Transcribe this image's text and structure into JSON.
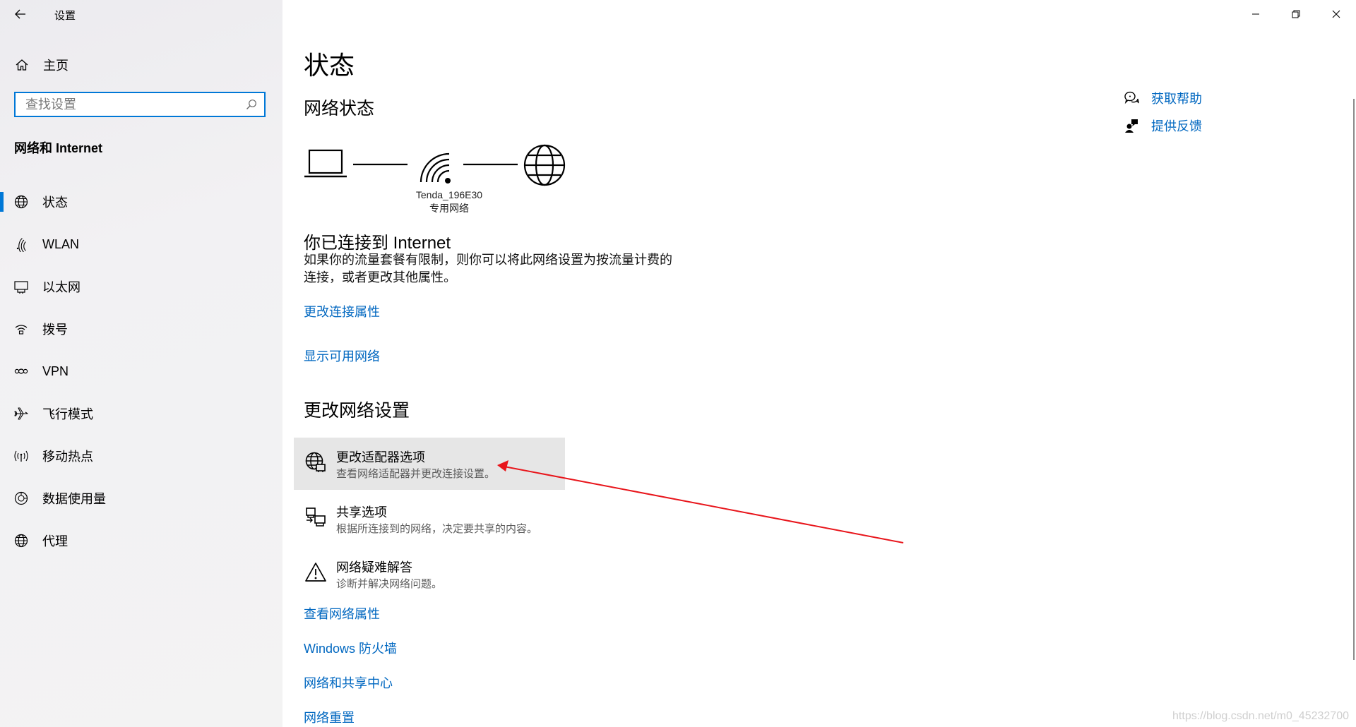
{
  "window": {
    "title": "设置",
    "controls": [
      "minimize",
      "restore",
      "close"
    ]
  },
  "sidebar": {
    "home_label": "主页",
    "search_placeholder": "查找设置",
    "section_title": "网络和 Internet",
    "items": [
      {
        "label": "状态",
        "icon": "globe-status-icon",
        "active": true
      },
      {
        "label": "WLAN",
        "icon": "wifi-icon",
        "active": false
      },
      {
        "label": "以太网",
        "icon": "ethernet-icon",
        "active": false
      },
      {
        "label": "拨号",
        "icon": "dialup-icon",
        "active": false
      },
      {
        "label": "VPN",
        "icon": "vpn-icon",
        "active": false
      },
      {
        "label": "飞行模式",
        "icon": "airplane-icon",
        "active": false
      },
      {
        "label": "移动热点",
        "icon": "hotspot-icon",
        "active": false
      },
      {
        "label": "数据使用量",
        "icon": "data-usage-icon",
        "active": false
      },
      {
        "label": "代理",
        "icon": "proxy-globe-icon",
        "active": false
      }
    ]
  },
  "main": {
    "title": "状态",
    "network_status_title": "网络状态",
    "network": {
      "name": "Tenda_196E30",
      "type": "专用网络"
    },
    "connected_title": "你已连接到 Internet",
    "connected_desc_line1": "如果你的流量套餐有限制，则你可以将此网络设置为按流量计费的",
    "connected_desc_line2": "连接，或者更改其他属性。",
    "links_top": {
      "change_connection_properties": "更改连接属性",
      "show_available_networks": "显示可用网络"
    },
    "change_settings_title": "更改网络设置",
    "options": [
      {
        "title": "更改适配器选项",
        "desc": "查看网络适配器并更改连接设置。",
        "icon": "adapter-globe-icon",
        "highlighted": true
      },
      {
        "title": "共享选项",
        "desc": "根据所连接到的网络，决定要共享的内容。",
        "icon": "sharing-icon",
        "highlighted": false
      },
      {
        "title": "网络疑难解答",
        "desc": "诊断并解决网络问题。",
        "icon": "warning-icon",
        "highlighted": false
      }
    ],
    "links_bottom": {
      "view_network_properties": "查看网络属性",
      "windows_firewall": "Windows 防火墙",
      "network_sharing_center": "网络和共享中心",
      "network_reset": "网络重置"
    }
  },
  "help": {
    "get_help": "获取帮助",
    "give_feedback": "提供反馈"
  },
  "colors": {
    "accent": "#0078d7",
    "link": "#0067c0",
    "annotation_arrow": "#e8151b"
  },
  "watermark": "https://blog.csdn.net/m0_45232700"
}
